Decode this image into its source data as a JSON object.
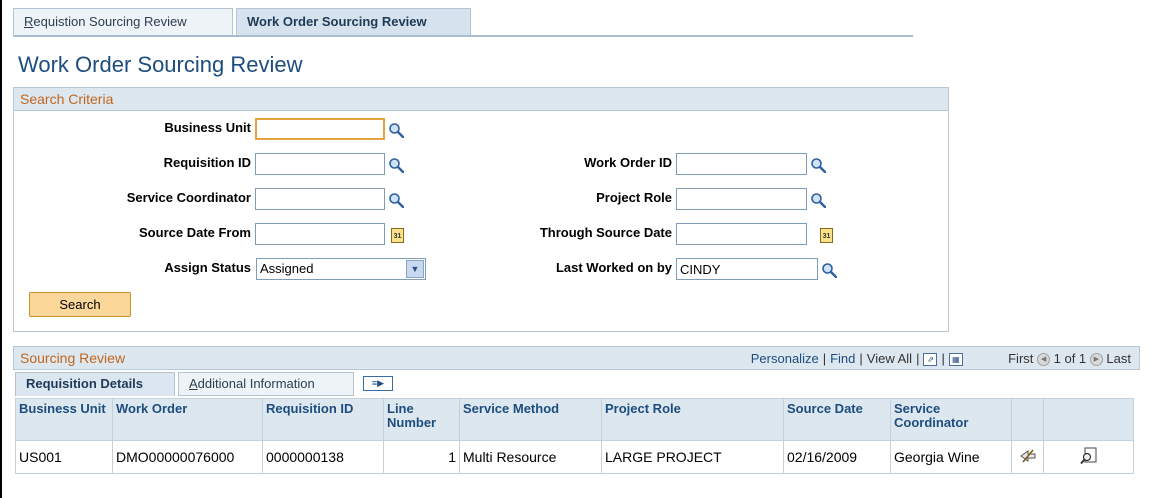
{
  "tabs": {
    "requisition": {
      "prefix": "R",
      "rest": "equistion Sourcing Review"
    },
    "work_order": "Work Order Sourcing Review"
  },
  "page_title": "Work Order Sourcing Review",
  "search_criteria": {
    "header": "Search Criteria",
    "business_unit": {
      "label": "Business Unit",
      "value": ""
    },
    "requisition_id": {
      "label": "Requisition ID",
      "value": ""
    },
    "work_order_id": {
      "label": "Work Order ID",
      "value": ""
    },
    "service_coordinator": {
      "label": "Service Coordinator",
      "value": ""
    },
    "project_role": {
      "label": "Project Role",
      "value": ""
    },
    "source_date_from": {
      "label": "Source Date From",
      "value": ""
    },
    "through_source_date": {
      "label": "Through Source Date",
      "value": ""
    },
    "assign_status": {
      "label": "Assign Status",
      "value": "Assigned"
    },
    "last_worked_on_by": {
      "label": "Last Worked on by",
      "value": "CINDY"
    },
    "search_button": "Search",
    "calendar_text": "31"
  },
  "sourcing_review": {
    "title": "Sourcing Review",
    "nav": {
      "personalize": "Personalize",
      "find": "Find",
      "view_all": "View All",
      "first": "First",
      "range": "1 of 1",
      "last": "Last"
    },
    "tabs": {
      "details": "Requisition Details",
      "additional": {
        "prefix": "A",
        "rest": "dditional Information"
      }
    },
    "columns": {
      "business_unit": "Business Unit",
      "work_order": "Work Order",
      "requisition_id": "Requisition ID",
      "line_number": "Line Number",
      "service_method": "Service Method",
      "project_role": "Project Role",
      "source_date": "Source Date",
      "service_coordinator": "Service Coordinator"
    },
    "rows": [
      {
        "business_unit": "US001",
        "work_order": "DMO00000076000",
        "requisition_id": "0000000138",
        "line_number": "1",
        "service_method": "Multi Resource",
        "project_role": "LARGE PROJECT",
        "source_date": "02/16/2009",
        "service_coordinator": "Georgia Wine"
      }
    ]
  },
  "colors": {
    "title_blue": "#1d4d7e",
    "section_orange": "#c0661e",
    "header_bg": "#dde7f0",
    "button_bg": "#fbd79a",
    "focus_border": "#e3a43b"
  }
}
